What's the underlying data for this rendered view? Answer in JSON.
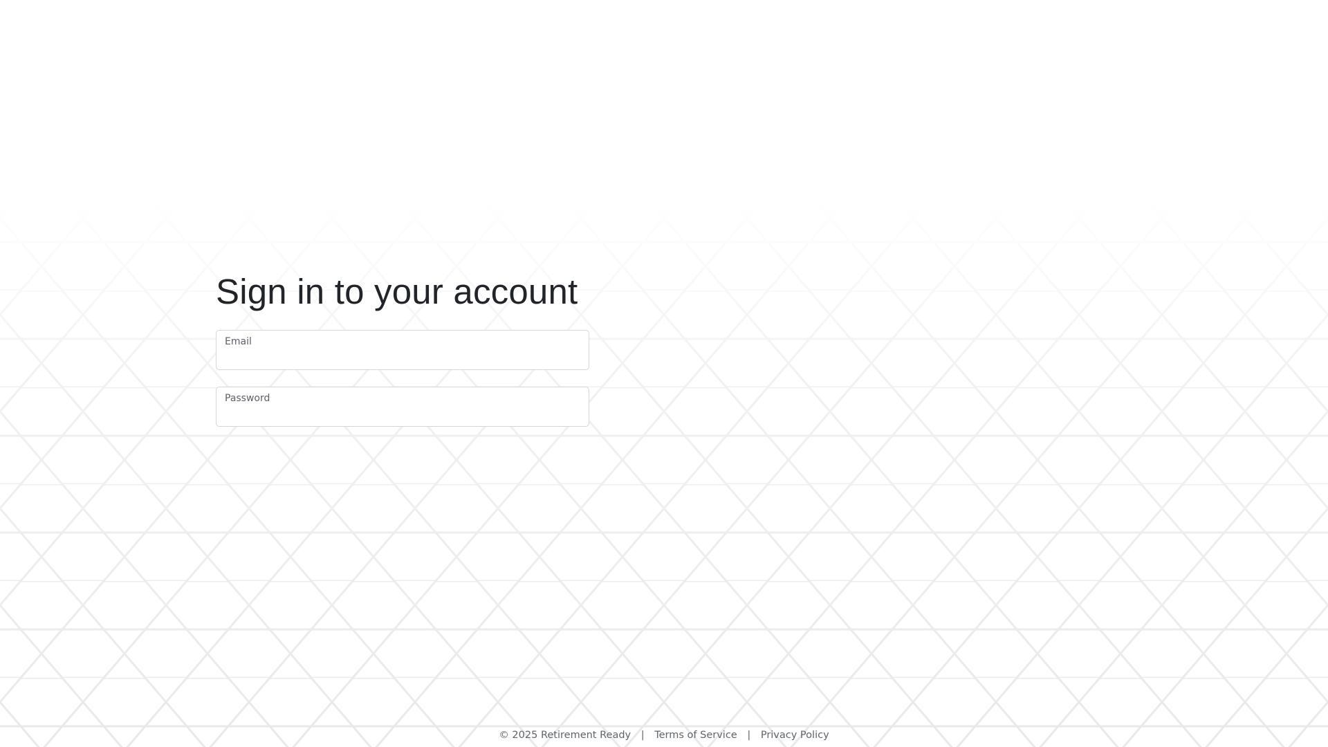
{
  "signin": {
    "title": "Sign in to your account",
    "email": {
      "label": "Email",
      "value": "",
      "placeholder": ""
    },
    "password": {
      "label": "Password",
      "value": "",
      "placeholder": ""
    }
  },
  "footer": {
    "copyright": "© 2025 Retirement Ready",
    "separator": "|",
    "terms_label": "Terms of Service",
    "privacy_label": "Privacy Policy"
  },
  "colors": {
    "background": "#ffffff",
    "text": "#212529",
    "muted": "#5f646a",
    "border": "#d3d6da",
    "hex_pattern": "#ececec"
  }
}
